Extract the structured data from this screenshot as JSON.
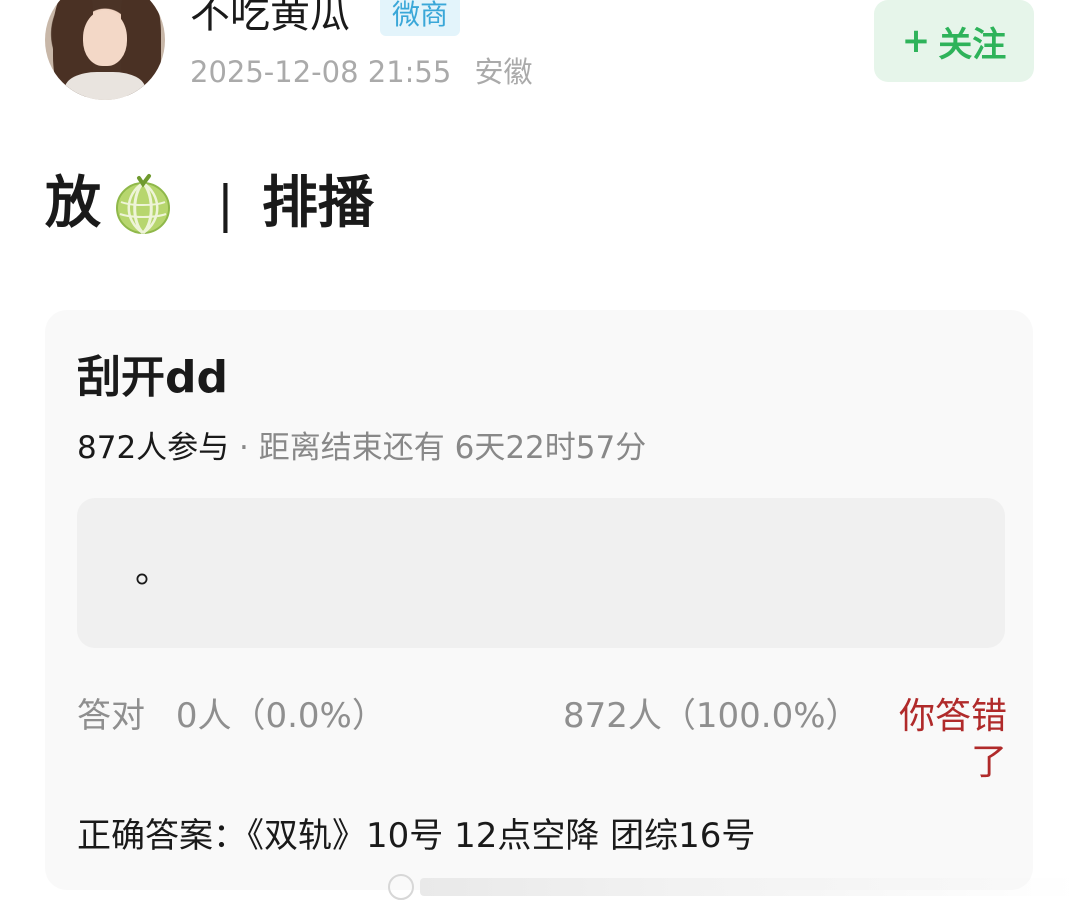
{
  "post": {
    "author": {
      "name": "不吃黄瓜",
      "badge": "微商",
      "timestamp": "2025-12-08 21:55",
      "location": "安徽"
    },
    "follow_label": "关注",
    "text_prefix": "放",
    "separator": "|",
    "text_suffix": "排播"
  },
  "quiz": {
    "title": "刮开dd",
    "participants": "872人参与",
    "dot": "·",
    "deadline": "距离结束还有 6天22时57分",
    "option_text": "。",
    "correct_label": "答对",
    "correct_stat": "0人（0.0%）",
    "wrong_stat": "872人（100.0%）",
    "result": "你答错了",
    "answer": "正确答案：《双轨》10号 12点空降 团综16号"
  },
  "colors": {
    "accent_green": "#2eb35a",
    "badge_blue": "#3aa7d8",
    "wrong_red": "#b02a2a"
  },
  "icons": {
    "follow": "plus-icon",
    "emoji": "melon-icon"
  }
}
